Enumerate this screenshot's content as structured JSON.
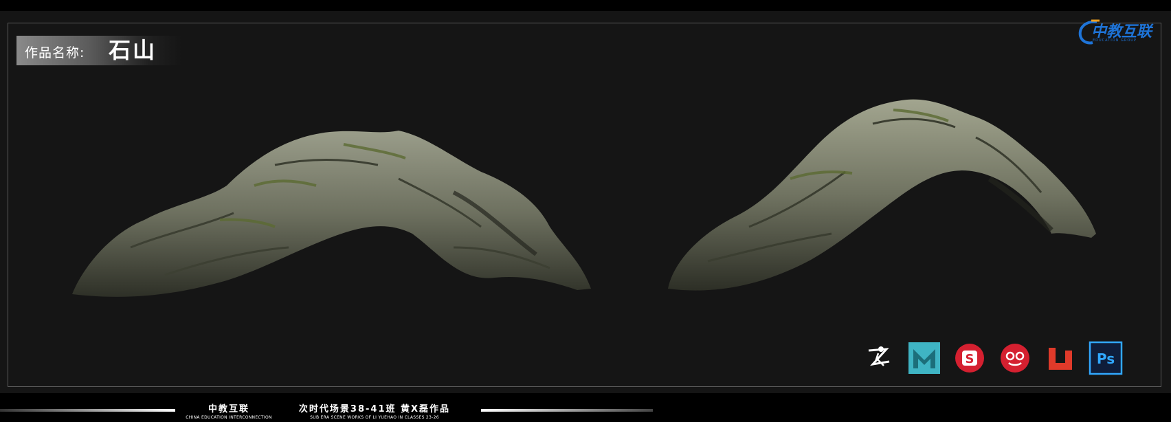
{
  "work": {
    "label": "作品名称:",
    "name": "石山"
  },
  "logo": {
    "text": "中教互联",
    "sub": "EDUCATION GROUP"
  },
  "tools": [
    {
      "icon": "zbrush-icon",
      "color": "#ffffff"
    },
    {
      "icon": "maya-icon",
      "color": "#3fb4c4"
    },
    {
      "icon": "substance-painter-icon",
      "color": "#d52030"
    },
    {
      "icon": "marmoset-toolbag-icon",
      "color": "#d52030"
    },
    {
      "icon": "unfold3d-icon",
      "color": "#e03a2a"
    },
    {
      "icon": "photoshop-icon",
      "color": "#31a8ff"
    }
  ],
  "footer": {
    "brand": "中教互联",
    "brand_sub": "CHINA EDUCATION INTERCONNECTION",
    "credit": "次时代场景38-41班 黄X磊作品",
    "credit_sub": "SUB ERA SCENE WORKS OF LI YUEHAO IN CLASSES 23-26"
  }
}
